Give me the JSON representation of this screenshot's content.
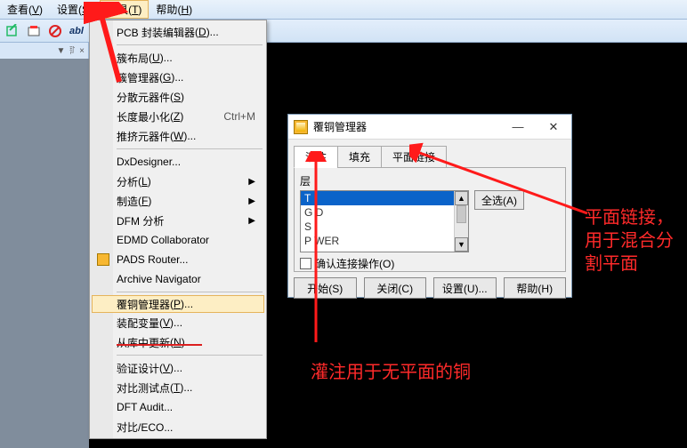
{
  "menubar": {
    "items": [
      {
        "label": "查看",
        "u": "V"
      },
      {
        "label": "设置",
        "u": "S"
      },
      {
        "label": "工具",
        "u": "T"
      },
      {
        "label": "帮助",
        "u": "H"
      }
    ]
  },
  "dropdown": {
    "items": [
      {
        "label": "PCB 封装编辑器",
        "u": "D",
        "after": "..."
      },
      {
        "sep": true
      },
      {
        "label": "簇布局",
        "u": "U",
        "after": "..."
      },
      {
        "label": "簇管理器",
        "u": "G",
        "after": "..."
      },
      {
        "label": "分散元器件",
        "u": "S"
      },
      {
        "label": "长度最小化",
        "u": "Z",
        "shortcut": "Ctrl+M"
      },
      {
        "label": "推挤元器件",
        "u": "W",
        "after": "..."
      },
      {
        "sep": true
      },
      {
        "label": "DxDesigner..."
      },
      {
        "label": "分析",
        "u": "L",
        "arrow": true
      },
      {
        "label": "制造",
        "u": "F",
        "arrow": true
      },
      {
        "label": "DFM 分析",
        "arrow": true
      },
      {
        "label": "EDMD Collaborator"
      },
      {
        "label": "PADS Router...",
        "icon": "pads"
      },
      {
        "label": "Archive Navigator"
      },
      {
        "sep": true
      },
      {
        "label": "覆铜管理器",
        "u": "P",
        "after": "...",
        "highlight": true
      },
      {
        "label": "装配变量",
        "u": "V",
        "after": "..."
      },
      {
        "label": "从库中更新",
        "u": "N",
        "after": "..."
      },
      {
        "sep": true
      },
      {
        "label": "验证设计",
        "u": "V",
        "after": "..."
      },
      {
        "label": "对比测试点",
        "u": "T",
        "after": "..."
      },
      {
        "label": "DFT Audit..."
      },
      {
        "label": "对比/ECO...",
        "u": ""
      }
    ]
  },
  "dialog": {
    "title": "覆铜管理器",
    "tabs": [
      "灌注",
      "填充",
      "平面链接"
    ],
    "layer_label": "层",
    "list": [
      "T",
      "G D",
      "S",
      "P WER"
    ],
    "all_btn": "全选(A)",
    "checkbox": "确认连接操作(O)",
    "buttons": [
      "开始(S)",
      "关闭(C)",
      "设置(U)...",
      "帮助(H)"
    ]
  },
  "small_strip": {
    "a": "▼",
    "b": "ꆌ",
    "c": "×"
  },
  "annotations": {
    "right": "平面链接，用于混合分割平面",
    "bottom": "灌注用于无平面的铜"
  }
}
